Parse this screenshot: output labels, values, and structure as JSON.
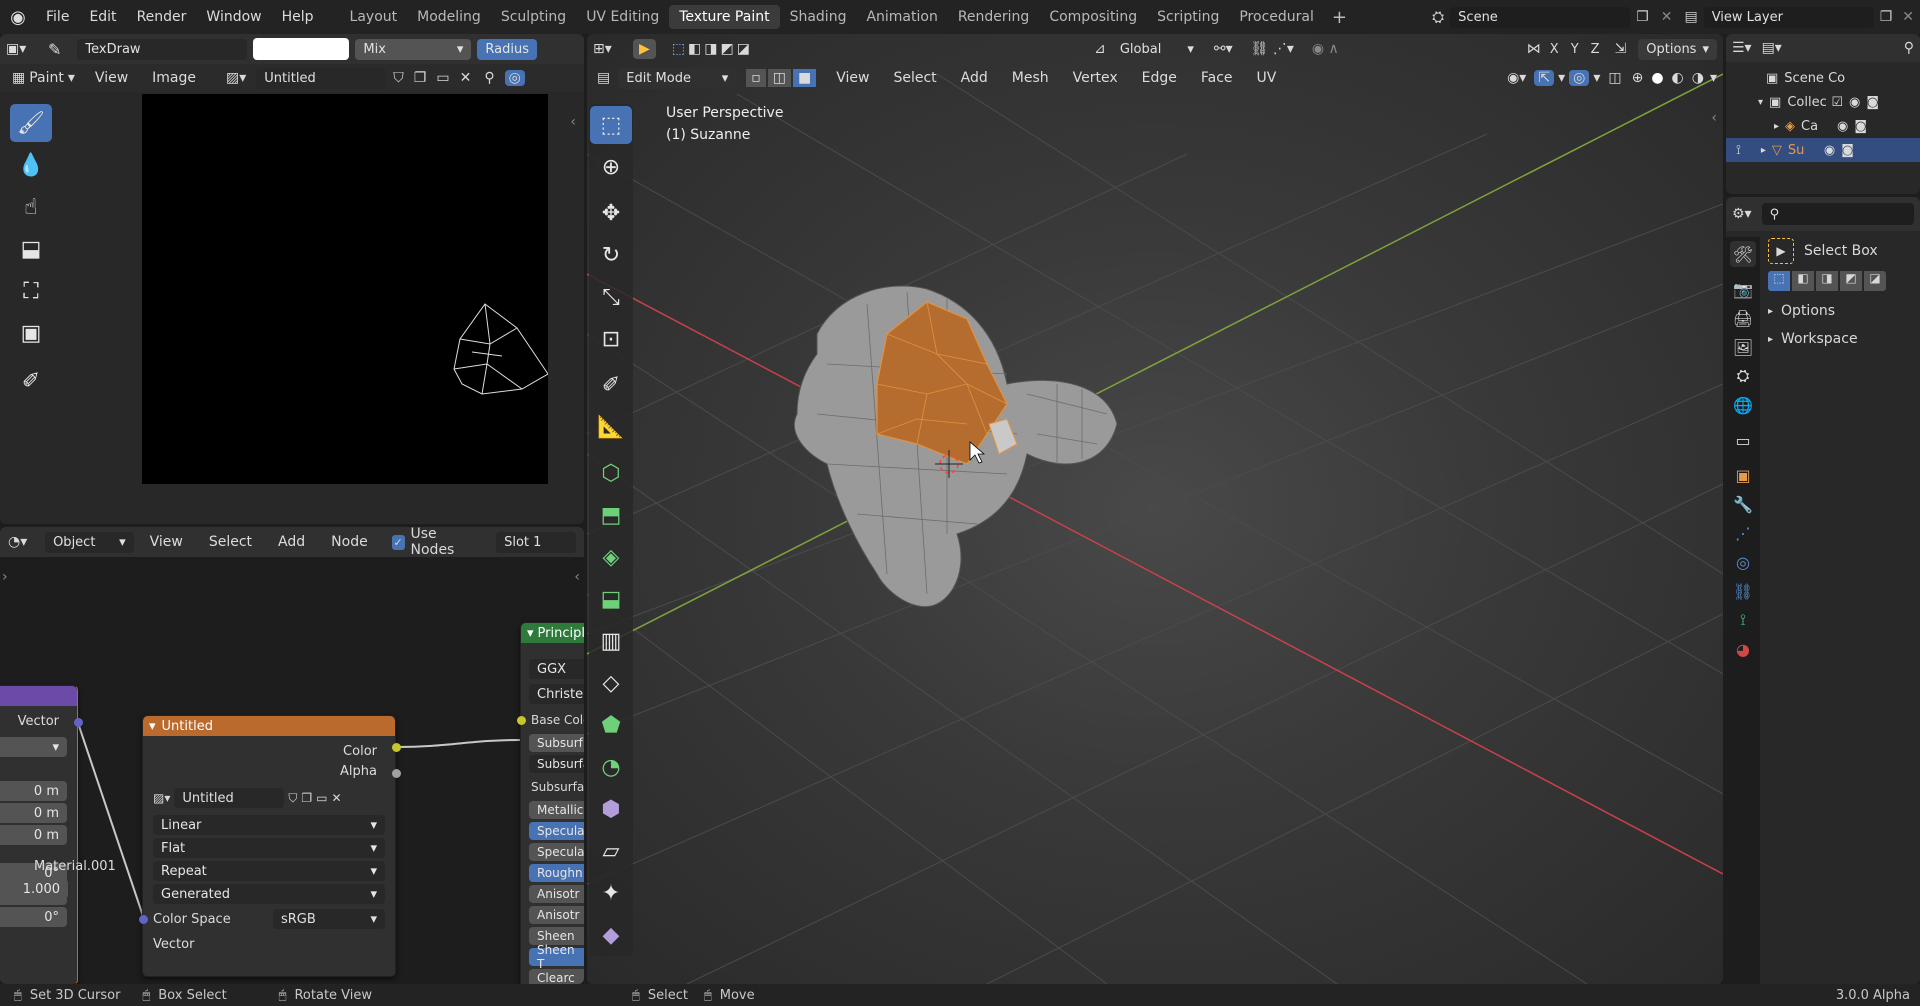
{
  "topbar": {
    "menus": [
      "File",
      "Edit",
      "Render",
      "Window",
      "Help"
    ],
    "workspaces": [
      "Layout",
      "Modeling",
      "Sculpting",
      "UV Editing",
      "Texture Paint",
      "Shading",
      "Animation",
      "Rendering",
      "Compositing",
      "Scripting",
      "Procedural"
    ],
    "active_workspace": "Texture Paint",
    "scene_label": "Scene",
    "view_layer_label": "View Layer"
  },
  "image_editor": {
    "brush_name": "TexDraw",
    "blend_mode": "Mix",
    "radius_label": "Radius",
    "mode_label": "Paint",
    "view_menu": "View",
    "image_menu": "Image",
    "image_name": "Untitled"
  },
  "node_editor": {
    "object_dropdown": "Object",
    "menus": [
      "View",
      "Select",
      "Add",
      "Node"
    ],
    "use_nodes_label": "Use Nodes",
    "slot_label": "Slot 1",
    "left_node": {
      "vector_label": "Vector",
      "values": [
        "0 m",
        "0 m",
        "0 m",
        "0°",
        "0°",
        "0°"
      ],
      "material_label": "Material.001",
      "scale_value": "1.000"
    },
    "image_node": {
      "title": "Untitled",
      "out_color": "Color",
      "out_alpha": "Alpha",
      "image_name": "Untitled",
      "interpolation": "Linear",
      "projection": "Flat",
      "extension": "Repeat",
      "source": "Generated",
      "color_space_label": "Color Space",
      "color_space_value": "sRGB",
      "in_vector": "Vector"
    },
    "principled_node": {
      "title": "Principl",
      "distribution": "GGX",
      "subsurface_method": "Christen",
      "inputs": [
        "Base Colo",
        "Subsurf",
        "Subsurfa",
        "Subsurfac",
        "Metallic",
        "Specula",
        "Specula",
        "Roughn",
        "Anisotr",
        "Anisotr",
        "Sheen",
        "Sheen T",
        "Clearc"
      ]
    }
  },
  "viewport": {
    "mode": "Edit Mode",
    "menus": [
      "View",
      "Select",
      "Add",
      "Mesh",
      "Vertex",
      "Edge",
      "Face",
      "UV"
    ],
    "orientation": "Global",
    "axes": [
      "X",
      "Y",
      "Z"
    ],
    "options_label": "Options",
    "perspective_label": "User Perspective",
    "object_label": "(1) Suzanne"
  },
  "outliner": {
    "scene_collection": "Scene Co",
    "collection": "Collec",
    "camera": "Ca",
    "suzanne": "Su"
  },
  "properties": {
    "tool_name": "Select Box",
    "options_label": "Options",
    "workspace_label": "Workspace"
  },
  "status_bar": {
    "items": [
      "Set 3D Cursor",
      "Box Select",
      "Rotate View",
      "Select",
      "Move"
    ],
    "version": "3.0.0 Alpha"
  },
  "colors": {
    "accent_blue": "#4772b3",
    "image_node_header": "#b96a2c",
    "face_select_orange": "#c9782f"
  }
}
